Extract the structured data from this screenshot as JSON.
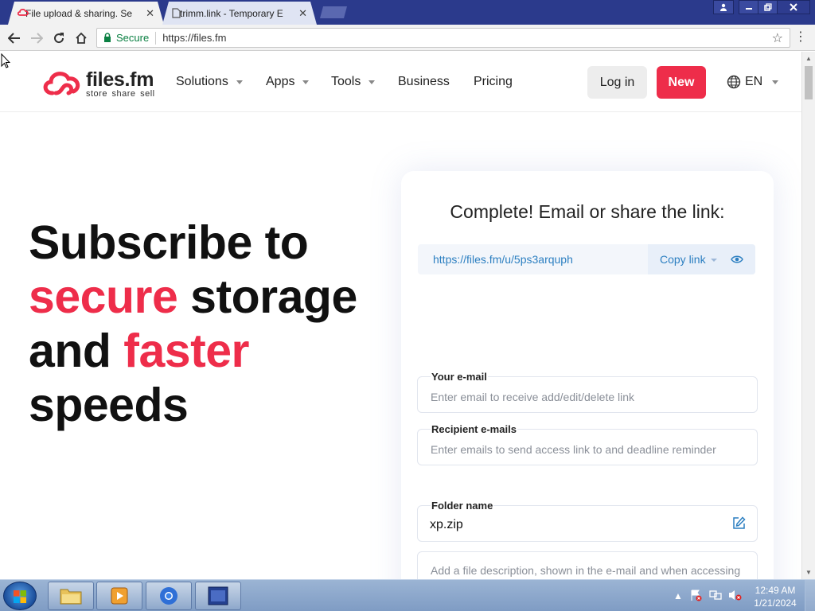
{
  "browser": {
    "tabs": [
      {
        "title": "File upload & sharing. Se",
        "active": true
      },
      {
        "title": "trimm.link - Temporary E",
        "active": false
      }
    ],
    "address": {
      "secure_label": "Secure",
      "url": "https://files.fm"
    }
  },
  "site": {
    "logo": {
      "name": "files.fm",
      "tagline": "store  share  sell"
    },
    "nav": [
      "Solutions",
      "Apps",
      "Tools",
      "Business",
      "Pricing"
    ],
    "login_label": "Log in",
    "new_label": "New",
    "lang_label": "EN",
    "brand_color": "#ee2d4a"
  },
  "hero": {
    "line1": "Subscribe to",
    "word_secure": "secure",
    "word_storage": " storage",
    "word_and": "and ",
    "word_faster": "faster",
    "line4": "speeds"
  },
  "share_card": {
    "title": "Complete! Email or share the link:",
    "link": "https://files.fm/u/5ps3arquph",
    "copy_label": "Copy link",
    "email_label": "Your e-mail",
    "email_placeholder": "Enter email to receive add/edit/delete link",
    "recipients_label": "Recipient e-mails",
    "recipients_placeholder": "Enter emails to send access link to and deadline reminder",
    "folder_label": "Folder name",
    "folder_value": "xp.zip",
    "description_placeholder": "Add a file description, shown in the e-mail and when accessing the files"
  },
  "taskbar": {
    "time": "12:49 AM",
    "date": "1/21/2024"
  }
}
